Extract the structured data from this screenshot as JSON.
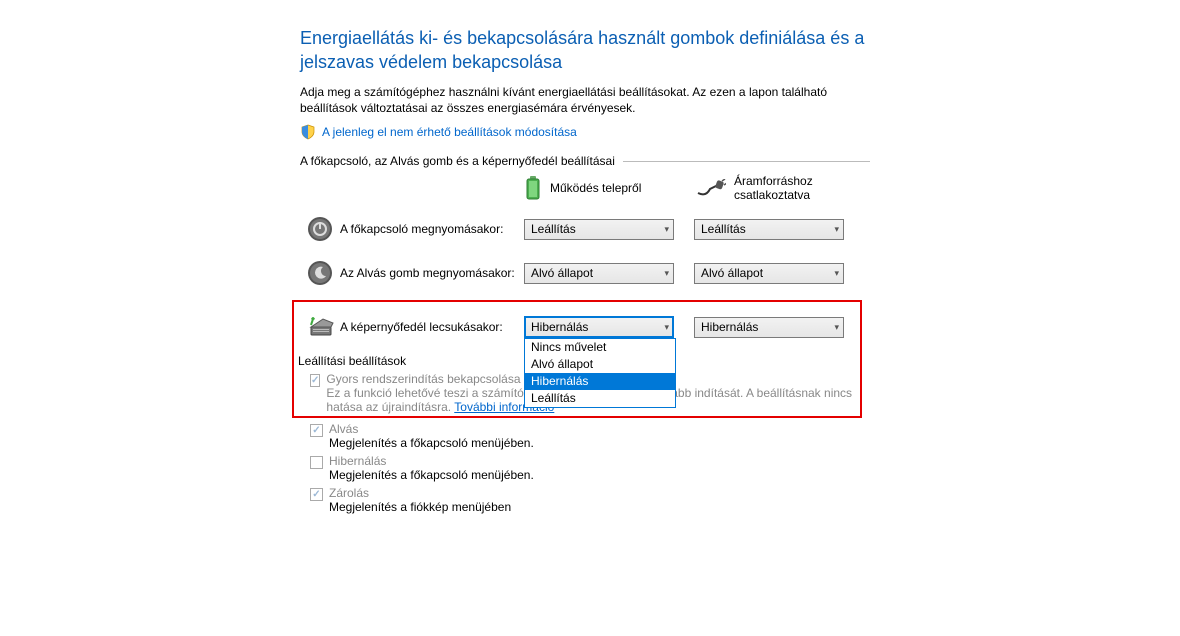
{
  "title": "Energiaellátás ki- és bekapcsolására használt gombok definiálása és a jelszavas védelem bekapcsolása",
  "description": "Adja meg a számítógéphez használni kívánt energiaellátási beállításokat. Az ezen a lapon található beállítások változtatásai az összes energiasémára érvényesek.",
  "modify_unavailable_link": "A jelenleg el nem érhető beállítások módosítása",
  "section_buttons_title": "A főkapcsoló, az Alvás gomb és a képernyőfedél beállításai",
  "col_battery": "Működés telepről",
  "col_ac": "Áramforráshoz csatlakoztatva",
  "rows": {
    "power_button": {
      "label": "A főkapcsoló megnyomásakor:",
      "battery": "Leállítás",
      "ac": "Leállítás"
    },
    "sleep_button": {
      "label": "Az Alvás gomb megnyomásakor:",
      "battery": "Alvó állapot",
      "ac": "Alvó állapot"
    },
    "lid_close": {
      "label": "A képernyőfedél lecsukásakor:",
      "battery": "Hibernálás",
      "ac": "Hibernálás"
    }
  },
  "dropdown_options": [
    "Nincs művelet",
    "Alvó állapot",
    "Hibernálás",
    "Leállítás"
  ],
  "dropdown_selected": "Hibernálás",
  "shutdown_section_title": "Leállítási beállítások",
  "fast_startup": {
    "label": "Gyors rendszerindítás bekapcsolása (ajánlott)",
    "label_cut": "Gyors rendszerindítás bekapcsolása (aj",
    "desc": "Ez a funkció lehetővé teszi a számítógép kikapcsolás utáni gyorsabb indítását. A beállításnak nincs hatása az újraindításra.",
    "more_info": "További információ"
  },
  "opt_sleep": {
    "label": "Alvás",
    "desc": "Megjelenítés a főkapcsoló menüjében."
  },
  "opt_hibernate": {
    "label": "Hibernálás",
    "desc": "Megjelenítés a főkapcsoló menüjében."
  },
  "opt_lock": {
    "label": "Zárolás",
    "desc": "Megjelenítés a fiókkép menüjében"
  }
}
